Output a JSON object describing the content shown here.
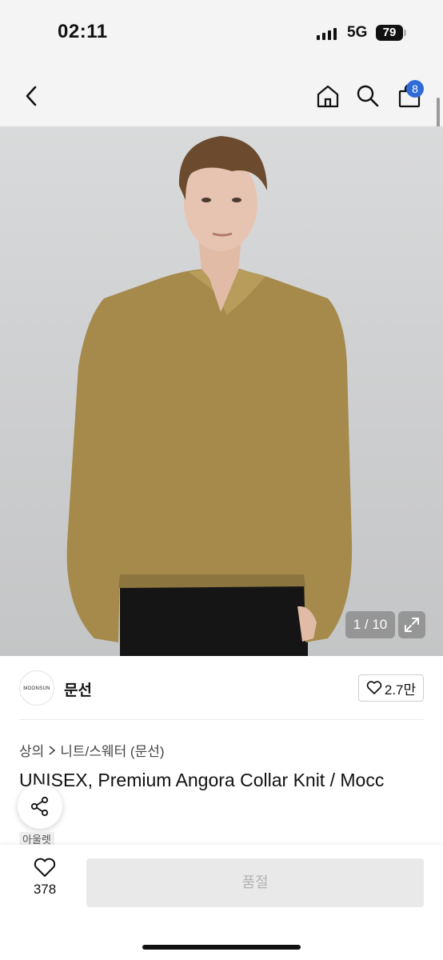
{
  "status_bar": {
    "time": "02:11",
    "network": "5G",
    "battery": "79"
  },
  "nav": {
    "cart_count": "8",
    "icons": [
      "chevron-left-icon",
      "home-icon",
      "search-icon",
      "shopping-bag-icon"
    ]
  },
  "gallery": {
    "counter": "1 / 10"
  },
  "brand": {
    "logo_text": "MOONSUN",
    "name": "문선",
    "likes": "2.7만"
  },
  "breadcrumb": {
    "category": "상의",
    "subcategory": "니트/스웨터 (문선)"
  },
  "product": {
    "title": "UNISEX, Premium Angora Collar Knit / Mocc",
    "tag": "아울렛"
  },
  "bottom_bar": {
    "wish_count": "378",
    "action_label": "품절"
  },
  "colors": {
    "accent": "#2f6bd6",
    "sweater": "#a58a4c",
    "background": "#cfd0d1"
  }
}
